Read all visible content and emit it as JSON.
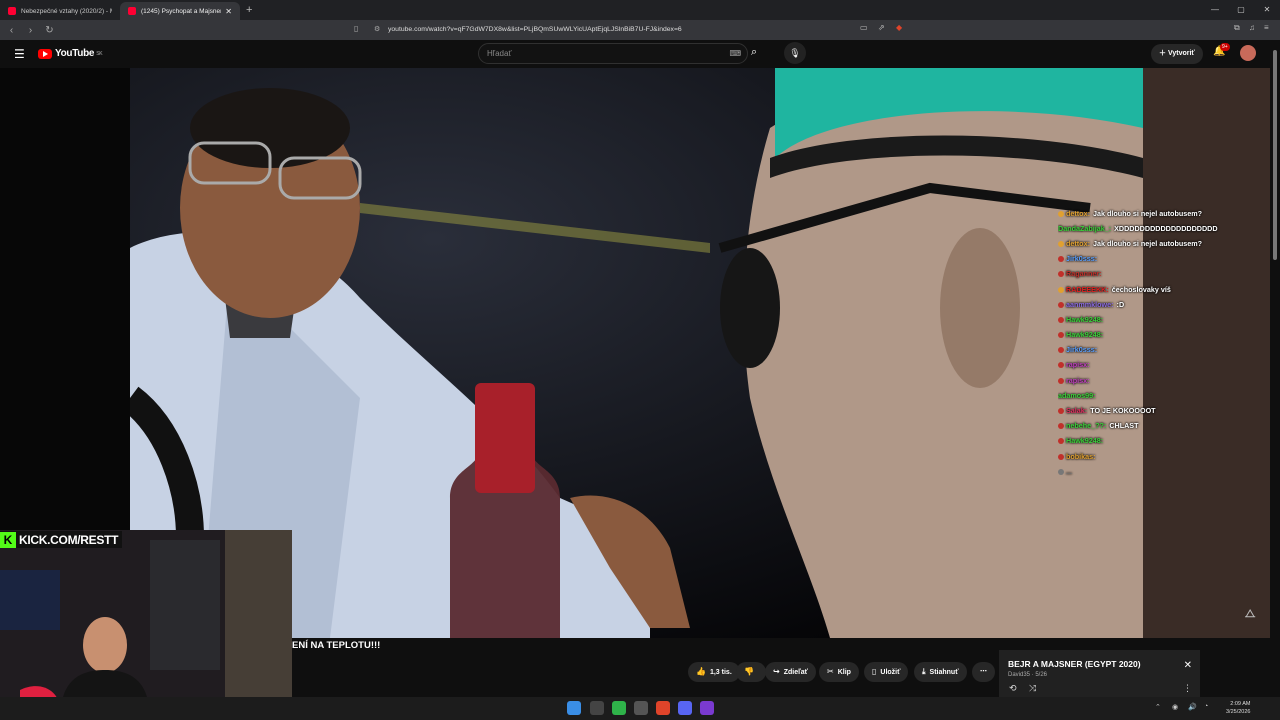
{
  "browser": {
    "tabs": [
      {
        "title": "Nebezpečné vztahy (2020/2) - Mejs",
        "active": false
      },
      {
        "title": "(1245) Psychopat a Majsner ...",
        "active": true
      }
    ],
    "url": "youtube.com/watch?v=qF7GdW7DX8w&list=PLjBQmSUwWLYicUAptEjqLJSlnBiB7U-FJ&index=6"
  },
  "youtube": {
    "logo_text": "YouTube",
    "region": "SK",
    "search_placeholder": "Hľadať",
    "create_label": "Vytvoriť",
    "notifications": "9+"
  },
  "stream": {
    "kick_label": "KICK.COM/RESTT",
    "chat": [
      {
        "user": "dettox:",
        "msg": "Jak dlouho si nejel autobusem?",
        "color": "#e0a030"
      },
      {
        "user": "DandaZabijak_:",
        "msg": "XDDDDDDDDDDDDDDDDDDD",
        "color": "#3ad13a"
      },
      {
        "user": "dettox:",
        "msg": "Jak dlouho si nejel autobusem?",
        "color": "#e0a030"
      },
      {
        "user": "Jirk0sss:",
        "msg": "",
        "color": "#5aa0ff"
      },
      {
        "user": "Raganner:",
        "msg": "",
        "color": "#c0302a"
      },
      {
        "user": "RADEEEKK:",
        "msg": "čechoslovaky víš",
        "color": "#e02020"
      },
      {
        "user": "aanmmklowe:",
        "msg": ":D",
        "color": "#8a6ae0"
      },
      {
        "user": "Hawk9248:",
        "msg": "",
        "color": "#3ad13a"
      },
      {
        "user": "Hawk9248:",
        "msg": "",
        "color": "#3ad13a"
      },
      {
        "user": "Jirk0sss:",
        "msg": "",
        "color": "#5aa0ff"
      },
      {
        "user": "rapisx:",
        "msg": "",
        "color": "#c040c0"
      },
      {
        "user": "rapisx:",
        "msg": "",
        "color": "#c040c0"
      },
      {
        "user": "adamos99:",
        "msg": "",
        "color": "#3ad13a"
      },
      {
        "user": "Salak:",
        "msg": "TO JE KOKOOOOT",
        "color": "#e03060"
      },
      {
        "user": "nebehe_??:",
        "msg": "CHLAST",
        "color": "#3ad13a"
      },
      {
        "user": "Hawk9248:",
        "msg": "",
        "color": "#3ad13a"
      },
      {
        "user": "bobikas:",
        "msg": "",
        "color": "#e0a030"
      },
      {
        "user": "...",
        "msg": "",
        "color": "#777777"
      }
    ]
  },
  "video": {
    "title_fragment": "ENÍ NA TEPLOTU!!!",
    "actions": {
      "likes": "1,3 tis.",
      "share": "Zdieľať",
      "clip": "Klip",
      "save": "Uložiť",
      "download": "Stiahnuť"
    }
  },
  "miniplayer": {
    "title": "BEJR A MAJSNER (EGYPT 2020)",
    "subtitle": "David35 · 5/26"
  },
  "taskbar": {
    "time": "2:09 AM",
    "date": "3/25/2026"
  }
}
